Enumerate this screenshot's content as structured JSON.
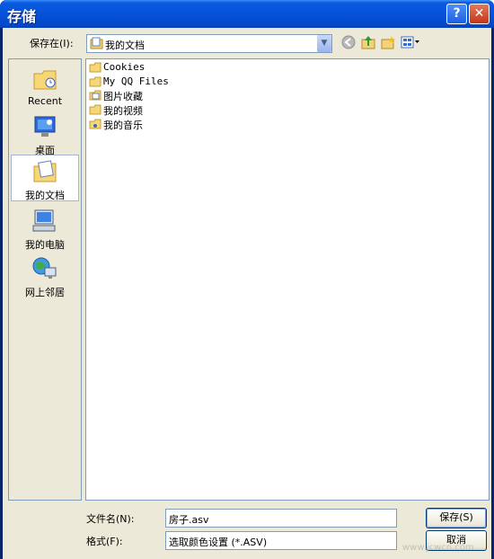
{
  "window": {
    "title": "存储"
  },
  "toolbar": {
    "save_in_label": "保存在(I):",
    "save_in_value": "我的文档"
  },
  "places": [
    {
      "label": "Recent"
    },
    {
      "label": "桌面"
    },
    {
      "label": "我的文档"
    },
    {
      "label": "我的电脑"
    },
    {
      "label": "网上邻居"
    }
  ],
  "files": [
    {
      "name": "Cookies",
      "icon": "folder-icon"
    },
    {
      "name": "My QQ Files",
      "icon": "folder-icon"
    },
    {
      "name": "图片收藏",
      "icon": "pictures-folder-icon"
    },
    {
      "name": "我的视频",
      "icon": "folder-icon"
    },
    {
      "name": "我的音乐",
      "icon": "music-folder-icon"
    }
  ],
  "form": {
    "filename_label": "文件名(N):",
    "filename_value": "房子.asv",
    "format_label": "格式(F):",
    "format_value": "选取颜色设置 (*.ASV)",
    "save_label": "保存(S)",
    "cancel_label": "取消"
  },
  "watermark": "www.jcwcn.com"
}
